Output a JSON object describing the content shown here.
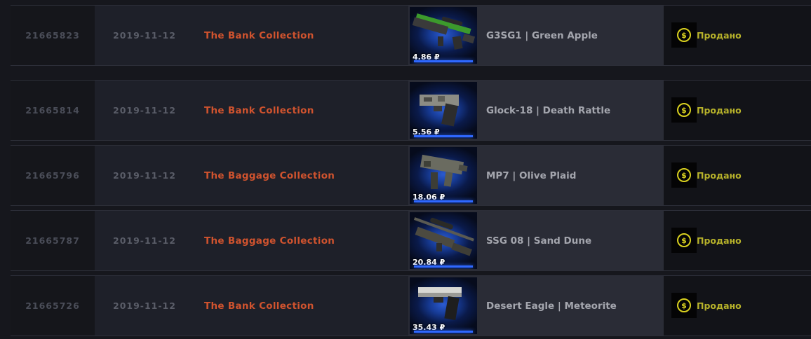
{
  "status_icon": "dollar-coin-icon",
  "colors": {
    "collection": "#d0532e",
    "status": "#b7b22a",
    "coin": "#d9d11f"
  },
  "rows": [
    {
      "id": "21665823",
      "date": "2019-11-12",
      "collection": "The Bank Collection",
      "item_name": "G3SG1 | Green Apple",
      "price": "4.86 ₽",
      "status": "Продано",
      "weapon_icon": "rifle-icon"
    },
    {
      "id": "21665814",
      "date": "2019-11-12",
      "collection": "The Bank Collection",
      "item_name": "Glock-18 | Death Rattle",
      "price": "5.56 ₽",
      "status": "Продано",
      "weapon_icon": "pistol-icon"
    },
    {
      "id": "21665796",
      "date": "2019-11-12",
      "collection": "The Baggage Collection",
      "item_name": "MP7 | Olive Plaid",
      "price": "18.06 ₽",
      "status": "Продано",
      "weapon_icon": "smg-icon"
    },
    {
      "id": "21665787",
      "date": "2019-11-12",
      "collection": "The Baggage Collection",
      "item_name": "SSG 08 | Sand Dune",
      "price": "20.84 ₽",
      "status": "Продано",
      "weapon_icon": "sniper-rifle-icon"
    },
    {
      "id": "21665726",
      "date": "2019-11-12",
      "collection": "The Bank Collection",
      "item_name": "Desert Eagle | Meteorite",
      "price": "35.43 ₽",
      "status": "Продано",
      "weapon_icon": "pistol-icon"
    }
  ]
}
